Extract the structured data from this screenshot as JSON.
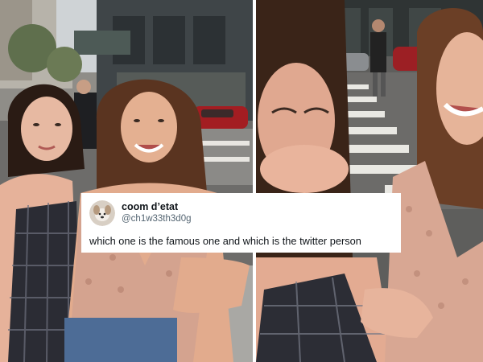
{
  "tweet": {
    "display_name": "coom d’etat",
    "handle": "@ch1w33th3d0g",
    "text": "which one is the famous one and which is the twitter person",
    "avatar_icon": "dog-avatar-icon"
  },
  "colors": {
    "card_background": "#ffffff",
    "name_text": "#0f1419",
    "handle_text": "#536471"
  }
}
